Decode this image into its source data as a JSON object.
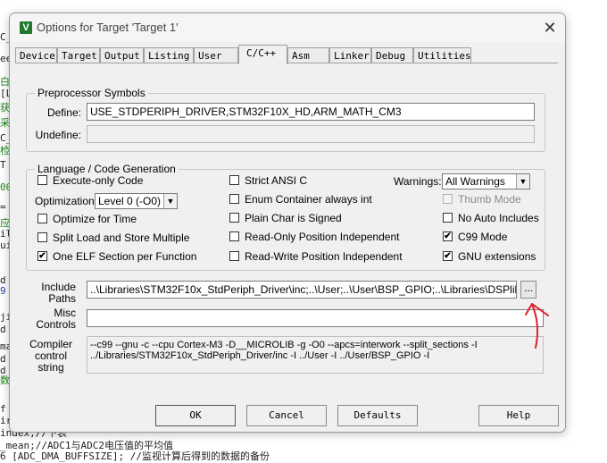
{
  "background_code": [
    {
      "t": "C_",
      "c": ""
    },
    {
      "t": "ee",
      "c": ""
    },
    {
      "t": "白",
      "c": "cmt"
    },
    {
      "t": "[L",
      "c": ""
    },
    {
      "t": "获",
      "c": "cmt"
    },
    {
      "t": "采",
      "c": "cmt"
    },
    {
      "t": "C_",
      "c": ""
    },
    {
      "t": "检",
      "c": "cmt"
    },
    {
      "t": "T",
      "c": ""
    },
    {
      "t": "00",
      "c": "cmt"
    },
    {
      "t": "=",
      "c": ""
    },
    {
      "t": "应",
      "c": "cmt"
    },
    {
      "t": "il",
      "c": ""
    },
    {
      "t": "ui",
      "c": ""
    },
    {
      "t": "d",
      "c": ""
    },
    {
      "t": "9",
      "c": "bl"
    },
    {
      "t": "ji",
      "c": ""
    },
    {
      "t": "d",
      "c": ""
    },
    {
      "t": "ma",
      "c": ""
    },
    {
      "t": "d",
      "c": ""
    },
    {
      "t": "d",
      "c": ""
    },
    {
      "t": "数",
      "c": "cmt"
    },
    {
      "t": "f",
      "c": ""
    },
    {
      "t": "ir",
      "c": ""
    },
    {
      "t": "index;//下表",
      "c": "mix"
    },
    {
      "t": "_mean;//ADC1与ADC2电压值的平均值",
      "c": "mix"
    },
    {
      "t": "6 [ADC_DMA_BUFFSIZE]; //监视计算后得到的数据的备份",
      "c": "mix"
    }
  ],
  "window": {
    "title": "Options for Target 'Target 1'",
    "close_glyph": "✕"
  },
  "tabs": [
    {
      "label": "Device"
    },
    {
      "label": "Target"
    },
    {
      "label": "Output"
    },
    {
      "label": "Listing"
    },
    {
      "label": "User"
    },
    {
      "label": "C/C++",
      "active": true
    },
    {
      "label": "Asm"
    },
    {
      "label": "Linker"
    },
    {
      "label": "Debug"
    },
    {
      "label": "Utilities"
    }
  ],
  "preprocessor": {
    "title": "Preprocessor Symbols",
    "define_label": "Define:",
    "define_value": "USE_STDPERIPH_DRIVER,STM32F10X_HD,ARM_MATH_CM3",
    "undefine_label": "Undefine:",
    "undefine_value": ""
  },
  "language": {
    "title": "Language / Code Generation",
    "execute_only": {
      "label": "Execute-only Code",
      "checked": false
    },
    "optimization_label": "Optimization:",
    "optimization_value": "Level 0 (-O0)",
    "optimize_time": {
      "label": "Optimize for Time",
      "checked": false
    },
    "split_load": {
      "label": "Split Load and Store Multiple",
      "checked": false
    },
    "one_elf": {
      "label": "One ELF Section per Function",
      "checked": true
    },
    "strict_ansi": {
      "label": "Strict ANSI C",
      "checked": false
    },
    "enum_container": {
      "label": "Enum Container always int",
      "checked": false
    },
    "plain_char": {
      "label": "Plain Char is Signed",
      "checked": false
    },
    "ro_pos": {
      "label": "Read-Only Position Independent",
      "checked": false
    },
    "rw_pos": {
      "label": "Read-Write Position Independent",
      "checked": false
    },
    "warnings_label": "Warnings:",
    "warnings_value": "All Warnings",
    "thumb_mode": {
      "label": "Thumb Mode",
      "checked": false,
      "disabled": true
    },
    "no_auto_includes": {
      "label": "No Auto Includes",
      "checked": false
    },
    "c99_mode": {
      "label": "C99 Mode",
      "checked": true
    },
    "gnu_extensions": {
      "label": "GNU extensions",
      "checked": true
    }
  },
  "include": {
    "label_line1": "Include",
    "label_line2": "Paths",
    "value": "..\\Libraries\\STM32F10x_StdPeriph_Driver\\inc;..\\User;..\\User\\BSP_GPIO;..\\Libraries\\DSPlib\\Includ",
    "browse_label": "..."
  },
  "misc": {
    "label_line1": "Misc",
    "label_line2": "Controls",
    "value": ""
  },
  "compiler": {
    "label_line1": "Compiler",
    "label_line2": "control",
    "label_line3": "string",
    "value": "--c99 --gnu -c --cpu Cortex-M3 -D__MICROLIB -g -O0 --apcs=interwork --split_sections -I\n../Libraries/STM32F10x_StdPeriph_Driver/inc -I ../User -I ../User/BSP_GPIO -I"
  },
  "buttons": {
    "ok": "OK",
    "cancel": "Cancel",
    "defaults": "Defaults",
    "help": "Help"
  },
  "annotation_color": "#e0202a",
  "check_glyph": "✔"
}
